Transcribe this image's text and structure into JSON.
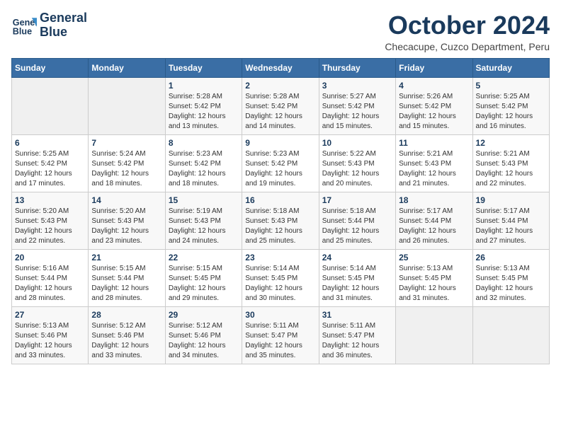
{
  "logo": {
    "line1": "General",
    "line2": "Blue"
  },
  "title": "October 2024",
  "subtitle": "Checacupe, Cuzco Department, Peru",
  "weekdays": [
    "Sunday",
    "Monday",
    "Tuesday",
    "Wednesday",
    "Thursday",
    "Friday",
    "Saturday"
  ],
  "days": [
    {
      "num": "",
      "info": ""
    },
    {
      "num": "",
      "info": ""
    },
    {
      "num": "1",
      "info": "Sunrise: 5:28 AM\nSunset: 5:42 PM\nDaylight: 12 hours and 13 minutes."
    },
    {
      "num": "2",
      "info": "Sunrise: 5:28 AM\nSunset: 5:42 PM\nDaylight: 12 hours and 14 minutes."
    },
    {
      "num": "3",
      "info": "Sunrise: 5:27 AM\nSunset: 5:42 PM\nDaylight: 12 hours and 15 minutes."
    },
    {
      "num": "4",
      "info": "Sunrise: 5:26 AM\nSunset: 5:42 PM\nDaylight: 12 hours and 15 minutes."
    },
    {
      "num": "5",
      "info": "Sunrise: 5:25 AM\nSunset: 5:42 PM\nDaylight: 12 hours and 16 minutes."
    },
    {
      "num": "6",
      "info": "Sunrise: 5:25 AM\nSunset: 5:42 PM\nDaylight: 12 hours and 17 minutes."
    },
    {
      "num": "7",
      "info": "Sunrise: 5:24 AM\nSunset: 5:42 PM\nDaylight: 12 hours and 18 minutes."
    },
    {
      "num": "8",
      "info": "Sunrise: 5:23 AM\nSunset: 5:42 PM\nDaylight: 12 hours and 18 minutes."
    },
    {
      "num": "9",
      "info": "Sunrise: 5:23 AM\nSunset: 5:42 PM\nDaylight: 12 hours and 19 minutes."
    },
    {
      "num": "10",
      "info": "Sunrise: 5:22 AM\nSunset: 5:43 PM\nDaylight: 12 hours and 20 minutes."
    },
    {
      "num": "11",
      "info": "Sunrise: 5:21 AM\nSunset: 5:43 PM\nDaylight: 12 hours and 21 minutes."
    },
    {
      "num": "12",
      "info": "Sunrise: 5:21 AM\nSunset: 5:43 PM\nDaylight: 12 hours and 22 minutes."
    },
    {
      "num": "13",
      "info": "Sunrise: 5:20 AM\nSunset: 5:43 PM\nDaylight: 12 hours and 22 minutes."
    },
    {
      "num": "14",
      "info": "Sunrise: 5:20 AM\nSunset: 5:43 PM\nDaylight: 12 hours and 23 minutes."
    },
    {
      "num": "15",
      "info": "Sunrise: 5:19 AM\nSunset: 5:43 PM\nDaylight: 12 hours and 24 minutes."
    },
    {
      "num": "16",
      "info": "Sunrise: 5:18 AM\nSunset: 5:43 PM\nDaylight: 12 hours and 25 minutes."
    },
    {
      "num": "17",
      "info": "Sunrise: 5:18 AM\nSunset: 5:44 PM\nDaylight: 12 hours and 25 minutes."
    },
    {
      "num": "18",
      "info": "Sunrise: 5:17 AM\nSunset: 5:44 PM\nDaylight: 12 hours and 26 minutes."
    },
    {
      "num": "19",
      "info": "Sunrise: 5:17 AM\nSunset: 5:44 PM\nDaylight: 12 hours and 27 minutes."
    },
    {
      "num": "20",
      "info": "Sunrise: 5:16 AM\nSunset: 5:44 PM\nDaylight: 12 hours and 28 minutes."
    },
    {
      "num": "21",
      "info": "Sunrise: 5:15 AM\nSunset: 5:44 PM\nDaylight: 12 hours and 28 minutes."
    },
    {
      "num": "22",
      "info": "Sunrise: 5:15 AM\nSunset: 5:45 PM\nDaylight: 12 hours and 29 minutes."
    },
    {
      "num": "23",
      "info": "Sunrise: 5:14 AM\nSunset: 5:45 PM\nDaylight: 12 hours and 30 minutes."
    },
    {
      "num": "24",
      "info": "Sunrise: 5:14 AM\nSunset: 5:45 PM\nDaylight: 12 hours and 31 minutes."
    },
    {
      "num": "25",
      "info": "Sunrise: 5:13 AM\nSunset: 5:45 PM\nDaylight: 12 hours and 31 minutes."
    },
    {
      "num": "26",
      "info": "Sunrise: 5:13 AM\nSunset: 5:45 PM\nDaylight: 12 hours and 32 minutes."
    },
    {
      "num": "27",
      "info": "Sunrise: 5:13 AM\nSunset: 5:46 PM\nDaylight: 12 hours and 33 minutes."
    },
    {
      "num": "28",
      "info": "Sunrise: 5:12 AM\nSunset: 5:46 PM\nDaylight: 12 hours and 33 minutes."
    },
    {
      "num": "29",
      "info": "Sunrise: 5:12 AM\nSunset: 5:46 PM\nDaylight: 12 hours and 34 minutes."
    },
    {
      "num": "30",
      "info": "Sunrise: 5:11 AM\nSunset: 5:47 PM\nDaylight: 12 hours and 35 minutes."
    },
    {
      "num": "31",
      "info": "Sunrise: 5:11 AM\nSunset: 5:47 PM\nDaylight: 12 hours and 36 minutes."
    },
    {
      "num": "",
      "info": ""
    },
    {
      "num": "",
      "info": ""
    }
  ]
}
